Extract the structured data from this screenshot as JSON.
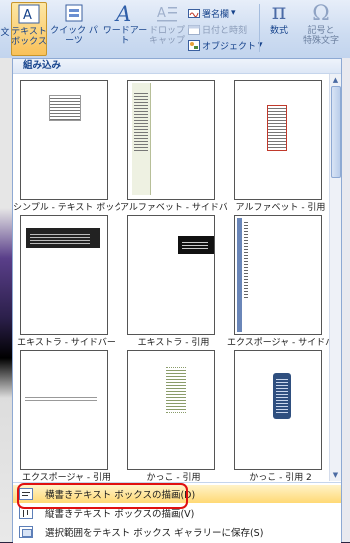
{
  "ribbon": {
    "partial_left_label": "文",
    "textbox_label": "テキスト\nボックス",
    "quickparts_label": "クイック パーツ",
    "wordart_label": "ワードアート",
    "dropcap_label": "ドロップ\nキャップ",
    "signature_label": "署名欄",
    "datetime_label": "日付と時刻",
    "object_label": "オブジェクト",
    "equation_label": "数式",
    "symbol_label": "記号と\n特殊文字"
  },
  "panel": {
    "header": "組み込み",
    "items": [
      {
        "caption": "シンプル - テキスト ボックス"
      },
      {
        "caption": "アルファベット - サイドバー"
      },
      {
        "caption": "アルファベット - 引用"
      },
      {
        "caption": "エキストラ - サイドバー"
      },
      {
        "caption": "エキストラ - 引用"
      },
      {
        "caption": "エクスポージャ - サイドバー"
      },
      {
        "caption": "エクスポージャ - 引用"
      },
      {
        "caption": "かっこ - 引用"
      },
      {
        "caption": "かっこ - 引用 2"
      }
    ],
    "footer": {
      "draw_horizontal": "横書きテキスト ボックスの描画(D)",
      "draw_vertical": "縦書きテキスト ボックスの描画(V)",
      "save_selection": "選択範囲をテキスト ボックス ギャラリーに保存(S)"
    }
  },
  "colors": {
    "highlight": "#ffd975",
    "annotation_ring": "#e01010",
    "ribbon_text": "#15428b"
  }
}
